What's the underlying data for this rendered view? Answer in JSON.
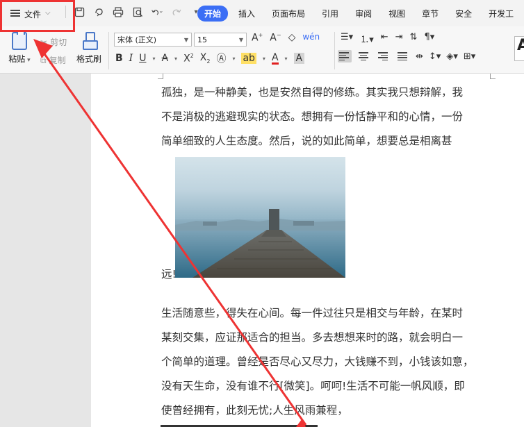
{
  "menubar": {
    "file_label": "文件",
    "tabs": [
      "开始",
      "插入",
      "页面布局",
      "引用",
      "审阅",
      "视图",
      "章节",
      "安全",
      "开发工"
    ],
    "active_tab": "开始"
  },
  "ribbon": {
    "paste_label": "粘贴",
    "cut_label": "剪切",
    "copy_label": "复制",
    "format_painter_label": "格式刷",
    "font_name": "宋体 (正文)",
    "font_size": "15",
    "big_style_letter": "A"
  },
  "colors": {
    "accent": "#3b6ef5",
    "highlight_box": "#ee3333",
    "text_highlight": "#ffe066",
    "font_color": "#e02020"
  },
  "document": {
    "para1": [
      "孤独，是一种静美，也是安然自得的修练。其实我只想辩解，我",
      "不是消极的逃避现实的状态。想拥有一份恬静平和的心情，一份",
      "简单细致的人生态度。然后，说的如此简单，想要总是相离甚"
    ],
    "image_caption_char": "远!",
    "para2": [
      "生活随意些，得失在心间。每一件过往只是相交与年龄，在某时",
      "某刻交集，应证那适合的担当。多去想想来时的路，就会明白一",
      "个简单的道理。曾经是否尽心又尽力，大钱赚不到，小钱该如意，",
      "没有天生命，没有谁不行[微笑]。呵呵!生活不可能一帆风顺，即",
      "使曾经拥有，此刻无忧;人生风雨兼程，"
    ]
  }
}
